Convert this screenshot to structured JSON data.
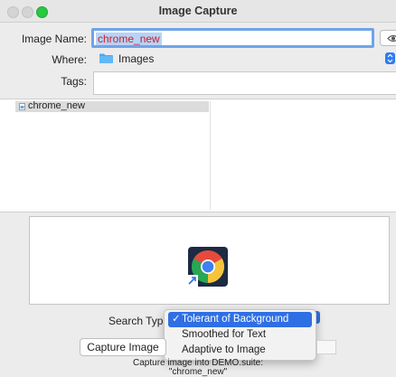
{
  "window": {
    "title": "Image Capture"
  },
  "form": {
    "image_name_label": "Image Name:",
    "image_name_value": "chrome_new",
    "where_label": "Where:",
    "where_value": "Images",
    "tags_label": "Tags:",
    "tags_value": ""
  },
  "list": {
    "items": [
      {
        "label": "chrome_new",
        "selected": true
      }
    ]
  },
  "search": {
    "label": "Search Type",
    "options": [
      "Tolerant of Background",
      "Smoothed for Text",
      "Adaptive to Image"
    ],
    "selected": "Tolerant of Background",
    "check_glyph": "✓"
  },
  "footer": {
    "capture_button": "Capture Image",
    "caption_line1": "Capture image into DEMO.suite:",
    "caption_line2": "\"chrome_new\""
  },
  "icons": {
    "eye": "eye-icon",
    "folder": "folder-icon",
    "image_file": "image-file-icon",
    "chrome": "chrome-logo-icon"
  },
  "colors": {
    "accent": "#2f6fe4",
    "close": "#fd5f57",
    "minimize": "#fdbc2e",
    "zoom": "#28c840",
    "folder": "#48a9f0"
  }
}
